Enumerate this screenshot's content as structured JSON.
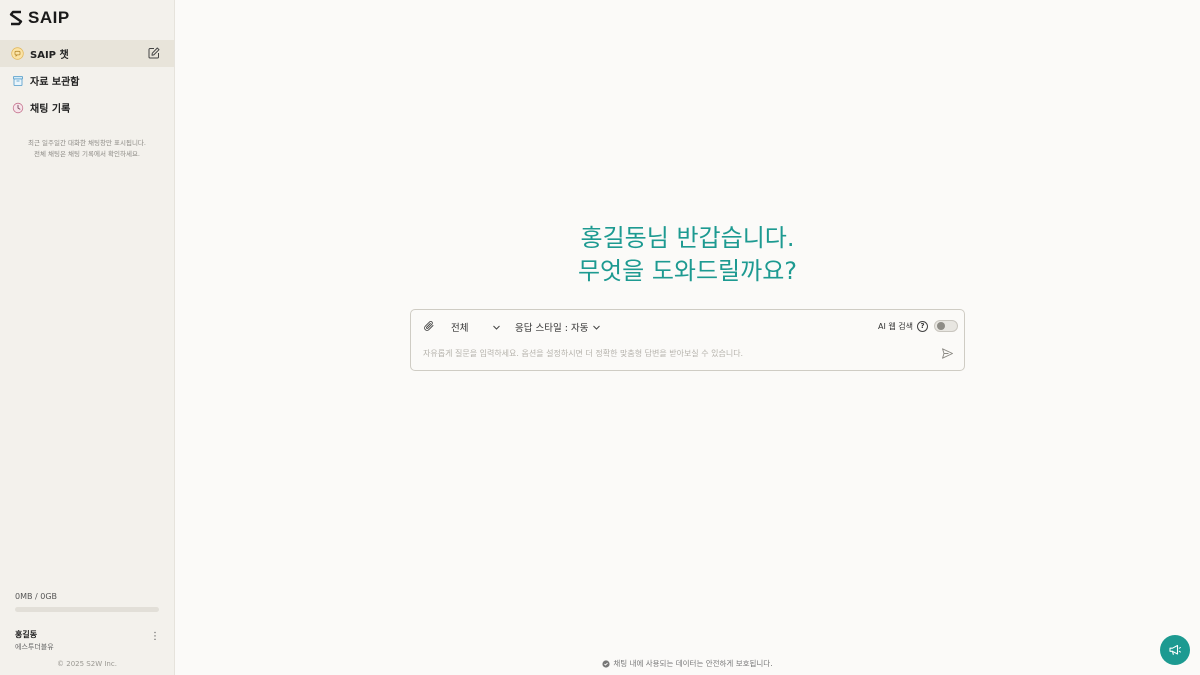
{
  "app": {
    "name": "SAIP"
  },
  "sidebar": {
    "items": [
      {
        "label": "SAIP 챗",
        "icon": "chat-bubble-icon",
        "active": true
      },
      {
        "label": "자료 보관함",
        "icon": "archive-icon",
        "active": false
      },
      {
        "label": "채팅 기록",
        "icon": "history-icon",
        "active": false
      }
    ],
    "hint_line1": "최근 일주일간 대화한 채팅창만 표시됩니다.",
    "hint_line2": "전체 채팅은 채팅 기록에서 확인하세요.",
    "storage": {
      "text": "0MB / 0GB",
      "used_fraction": 0
    },
    "user": {
      "name": "홍길동",
      "org": "에스투더블유"
    },
    "copyright": "© 2025 S2W Inc."
  },
  "main": {
    "greeting_line1": "홍길동님 반갑습니다.",
    "greeting_line2": "무엇을 도와드릴까요?",
    "chat": {
      "scope_label": "전체",
      "style_label": "응답 스타일 : 자동",
      "web_search_label": "AI 웹 검색",
      "web_search_enabled": false,
      "placeholder": "자유롭게 질문을 입력하세요. 옵션을 설정하시면 더 정확한 맞춤형 답변을 받아보실 수 있습니다."
    },
    "footer_note": "채팅 내에 사용되는 데이터는 안전하게 보호됩니다."
  },
  "colors": {
    "accent": "#1d9a91",
    "sidebar_bg": "#f3f1ec",
    "main_bg": "#fbfaf8"
  }
}
